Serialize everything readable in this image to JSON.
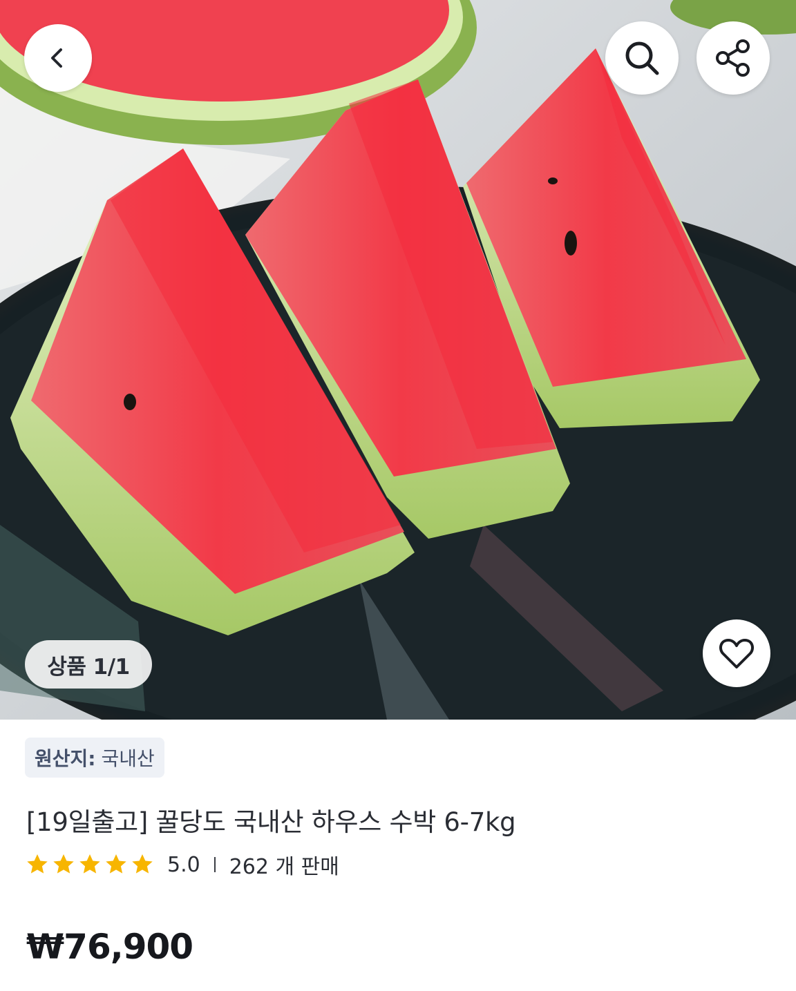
{
  "gallery": {
    "counter_label": "상품 1/1"
  },
  "icons": {
    "back": "chevron-left-icon",
    "search": "search-icon",
    "share": "share-icon",
    "like": "heart-icon",
    "star": "star-icon"
  },
  "product": {
    "origin_key": "원산지:",
    "origin_value": "국내산",
    "title": "[19일출고] 꿀당도 국내산 하우스 수박 6-7kg",
    "rating": "5.0",
    "sales": "262 개 판매",
    "stars": 5,
    "price": "₩76,900"
  },
  "colors": {
    "star": "#f7b500",
    "price": "#16181d",
    "badge_bg": "#eef1f6"
  }
}
